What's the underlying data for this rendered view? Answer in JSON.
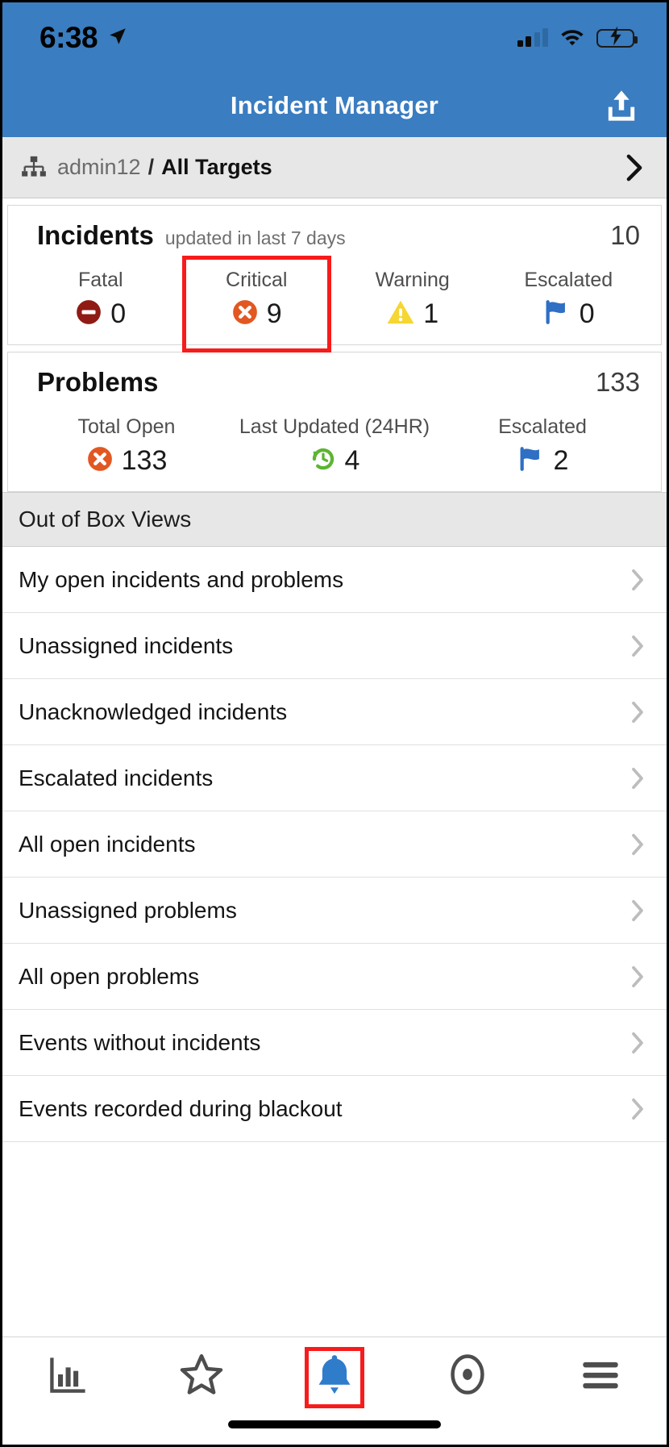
{
  "status_bar": {
    "time": "6:38",
    "location_icon": "location-arrow-icon",
    "signal_icon": "cellular-signal-icon",
    "wifi_icon": "wifi-icon",
    "battery_icon": "battery-charging-icon"
  },
  "app_bar": {
    "title": "Incident Manager",
    "action_icon": "upload-share-icon"
  },
  "breadcrumb": {
    "hierarchy_icon": "hierarchy-icon",
    "user": "admin12",
    "separator": "/",
    "current": "All Targets",
    "chevron_icon": "chevron-right-icon"
  },
  "incidents_card": {
    "title": "Incidents",
    "subtitle": "updated in last 7 days",
    "total": "10",
    "metrics": [
      {
        "label": "Fatal",
        "value": "0",
        "icon": "minus-circle-icon",
        "color": "#8f1b14",
        "highlighted": false
      },
      {
        "label": "Critical",
        "value": "9",
        "icon": "x-circle-icon",
        "color": "#e25822",
        "highlighted": true
      },
      {
        "label": "Warning",
        "value": "1",
        "icon": "warning-triangle-icon",
        "color": "#f5d633",
        "highlighted": false
      },
      {
        "label": "Escalated",
        "value": "0",
        "icon": "flag-icon",
        "color": "#2f6fc4",
        "highlighted": false
      }
    ]
  },
  "problems_card": {
    "title": "Problems",
    "subtitle": "",
    "total": "133",
    "metrics": [
      {
        "label": "Total Open",
        "value": "133",
        "icon": "x-circle-icon",
        "color": "#e25822"
      },
      {
        "label": "Last Updated (24HR)",
        "value": "4",
        "icon": "clock-rotate-left-icon",
        "color": "#5cb531"
      },
      {
        "label": "Escalated",
        "value": "2",
        "icon": "flag-icon",
        "color": "#2f6fc4"
      }
    ]
  },
  "section": {
    "header": "Out of Box Views"
  },
  "views": [
    {
      "label": "My open incidents and problems"
    },
    {
      "label": "Unassigned incidents"
    },
    {
      "label": "Unacknowledged incidents"
    },
    {
      "label": "Escalated incidents"
    },
    {
      "label": "All open incidents"
    },
    {
      "label": "Unassigned problems"
    },
    {
      "label": "All open problems"
    },
    {
      "label": "Events without incidents"
    },
    {
      "label": "Events recorded during blackout"
    }
  ],
  "tab_bar": {
    "tabs": [
      {
        "name": "tab-dashboard",
        "icon": "bar-chart-icon",
        "active": false
      },
      {
        "name": "tab-favorites",
        "icon": "star-icon",
        "active": false
      },
      {
        "name": "tab-alerts",
        "icon": "bell-icon",
        "active": true
      },
      {
        "name": "tab-targets",
        "icon": "target-circle-icon",
        "active": false
      },
      {
        "name": "tab-menu",
        "icon": "hamburger-menu-icon",
        "active": false
      }
    ]
  },
  "colors": {
    "app_bar_blue": "#3a7dc0",
    "highlight_red": "#f81b1b",
    "active_tab_blue": "#2f7ccb",
    "section_gray": "#e7e7e7"
  }
}
